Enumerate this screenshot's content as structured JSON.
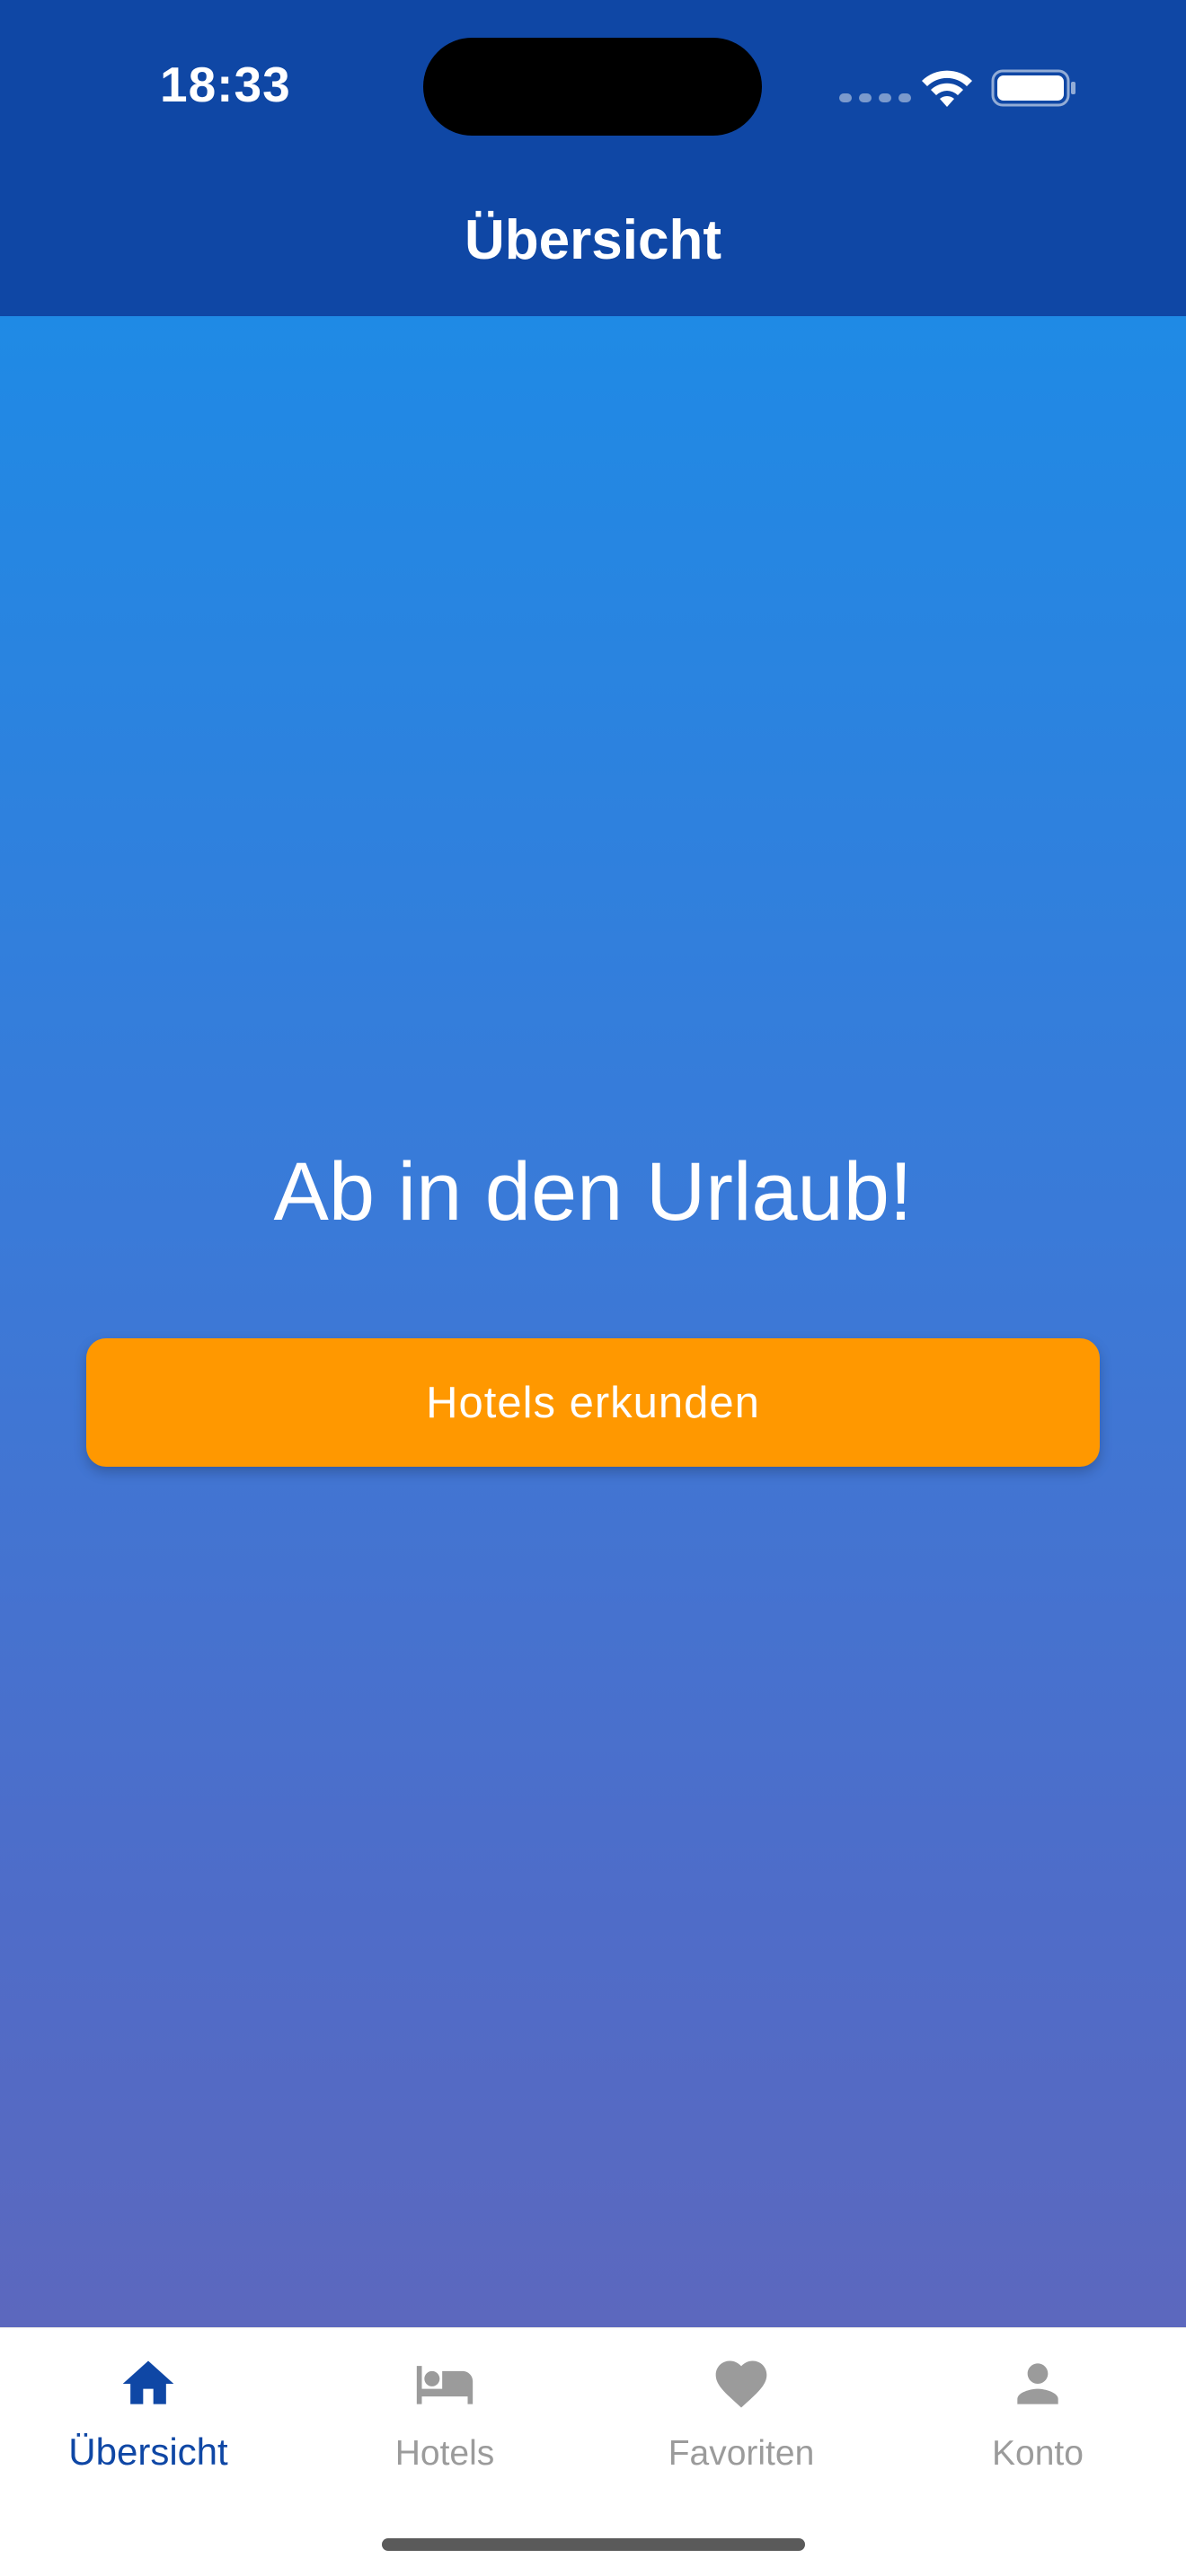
{
  "status_bar": {
    "time": "18:33"
  },
  "nav_bar": {
    "title": "Übersicht"
  },
  "main": {
    "headline": "Ab in den Urlaub!",
    "cta_label": "Hotels erkunden"
  },
  "tab_bar": {
    "items": [
      {
        "label": "Übersicht",
        "icon": "home-icon",
        "active": true
      },
      {
        "label": "Hotels",
        "icon": "bed-icon",
        "active": false
      },
      {
        "label": "Favoriten",
        "icon": "heart-icon",
        "active": false
      },
      {
        "label": "Konto",
        "icon": "person-icon",
        "active": false
      }
    ]
  },
  "colors": {
    "header": "#0f47a5",
    "accent_button": "#ff9800",
    "gradient_top": "#1f8ae5",
    "gradient_bottom": "#5c68be",
    "tab_active": "#0f47a5",
    "tab_inactive": "#9b9b9b"
  }
}
